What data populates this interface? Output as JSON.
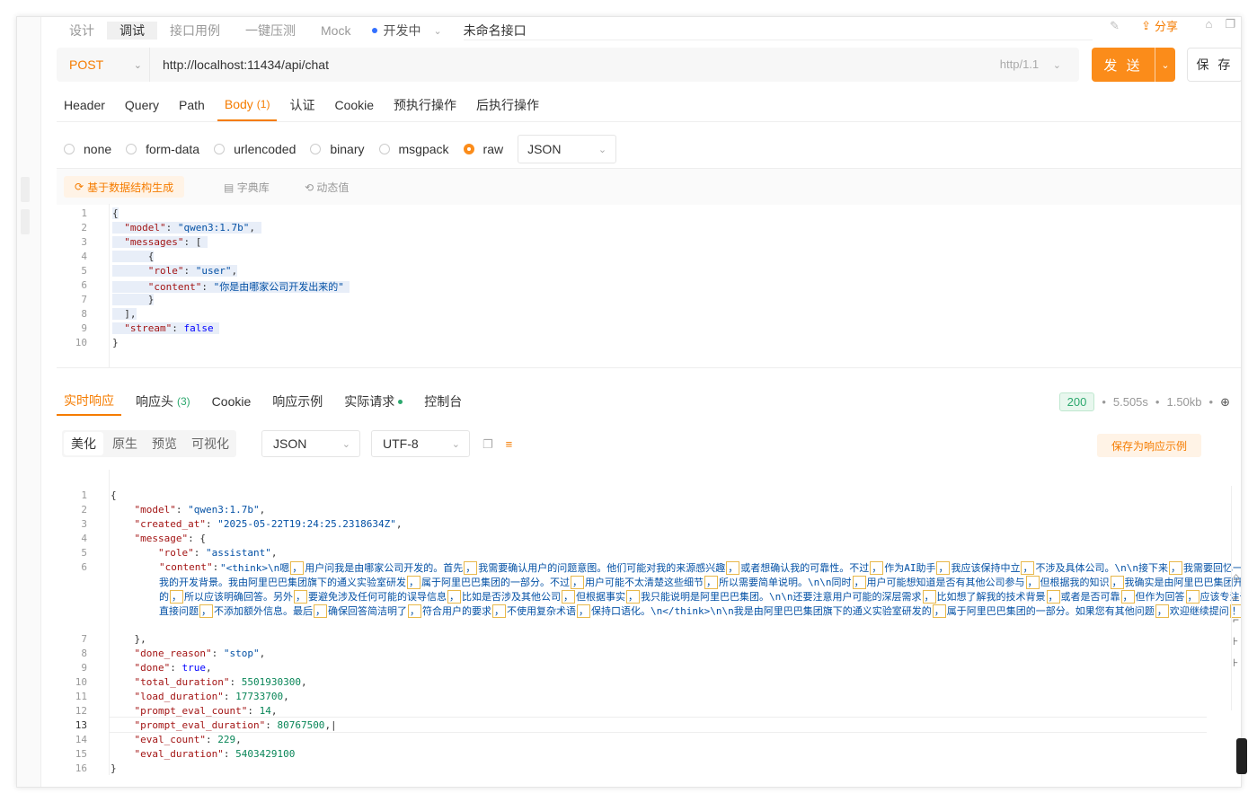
{
  "top_tabs": [
    "设计",
    "调试",
    "接口用例",
    "一键压测",
    "Mock"
  ],
  "status": "开发中",
  "api_name": "未命名接口",
  "share_label": "分享",
  "method": "POST",
  "url": "http://localhost:11434/api/chat",
  "http_version": "http/1.1",
  "send_label": "发 送",
  "save_label": "保 存",
  "req_tabs": [
    {
      "label": "Header",
      "count": ""
    },
    {
      "label": "Query",
      "count": ""
    },
    {
      "label": "Path",
      "count": ""
    },
    {
      "label": "Body",
      "count": "(1)"
    },
    {
      "label": "认证",
      "count": ""
    },
    {
      "label": "Cookie",
      "count": ""
    },
    {
      "label": "预执行操作",
      "count": ""
    },
    {
      "label": "后执行操作",
      "count": ""
    }
  ],
  "body_types": [
    "none",
    "form-data",
    "urlencoded",
    "binary",
    "msgpack",
    "raw"
  ],
  "body_format": "JSON",
  "editor_tools": {
    "generate": "基于数据结构生成",
    "dictionary": "字典库",
    "dynamic": "动态值"
  },
  "request_json": {
    "model": "qwen3:1.7b",
    "role": "user",
    "content": "你是由哪家公司开发出来的",
    "stream": "false"
  },
  "resp_tabs": [
    {
      "label": "实时响应",
      "count": ""
    },
    {
      "label": "响应头",
      "count": "(3)"
    },
    {
      "label": "Cookie",
      "count": ""
    },
    {
      "label": "响应示例",
      "count": ""
    },
    {
      "label": "实际请求",
      "count": ""
    },
    {
      "label": "控制台",
      "count": ""
    }
  ],
  "response_meta": {
    "status": "200",
    "time": "5.505s",
    "size": "1.50kb"
  },
  "view_tabs": [
    "美化",
    "原生",
    "预览",
    "可视化"
  ],
  "resp_format": "JSON",
  "resp_encoding": "UTF-8",
  "save_sample_label": "保存为响应示例",
  "response_json": {
    "model": "qwen3:1.7b",
    "created_at": "2025-05-22T19:24:25.2318634Z",
    "role": "assistant",
    "content_parts": [
      "\"<think>\\n嗯",
      "用户问我是由哪家公司开发的。首先",
      "我需要确认用户的问题意图。他们可能对我的来源感兴趣",
      "或者想确认我的可靠性。不过",
      "作为AI助手",
      "我应该保持中立",
      "不涉及具体公司。\\n\\n接下来",
      "我需要回忆一下我的开发背景。我由阿里巴巴集团旗下的通义实验室研发",
      "属于阿里巴巴集团的一部分。不过",
      "用户可能不太清楚这些细节",
      "所以需要简单说明。\\n\\n同时",
      "用户可能想知道是否有其他公司参与",
      "但根据我的知识",
      "我确实是由阿里巴巴集团开发的",
      "所以应该明确回答。另外",
      "要避免涉及任何可能的误导信息",
      "比如是否涉及其他公司",
      "但根据事实",
      "我只能说明是阿里巴巴集团。\\n\\n还要注意用户可能的深层需求",
      "比如想了解我的技术背景",
      "或者是否可靠",
      "但作为回答",
      "应该专注于直接问题",
      "不添加额外信息。最后",
      "确保回答简洁明了",
      "符合用户的要求",
      "不使用复杂术语",
      "保持口语化。\\n</think>\\n\\n我是由阿里巴巴集团旗下的通义实验室研发的",
      "属于阿里巴巴集团的一部分。如果您有其他问题",
      "欢迎继续提问",
      "\""
    ],
    "done_reason": "stop",
    "done": "true",
    "total_duration": "5501930300",
    "load_duration": "17733700",
    "prompt_eval_count": "14",
    "prompt_eval_duration": "80767500",
    "eval_count": "229",
    "eval_duration": "5403429100"
  }
}
